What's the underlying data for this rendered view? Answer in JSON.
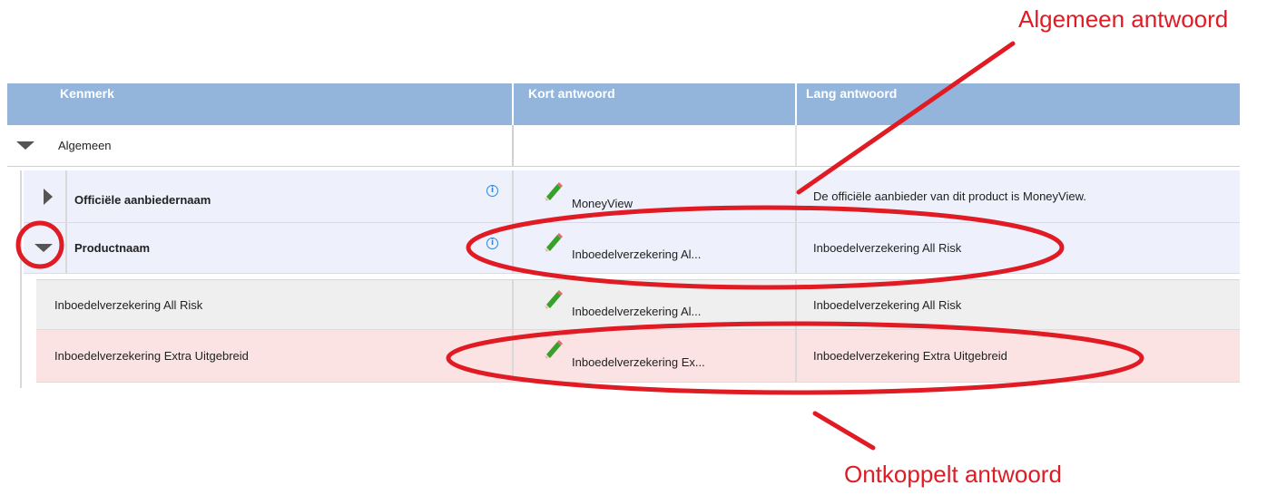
{
  "annotations": {
    "top_label": "Algemeen antwoord",
    "bottom_label": "Ontkoppelt antwoord",
    "color": "#e01b24"
  },
  "table": {
    "columns": [
      "Kenmerk",
      "Kort antwoord",
      "Lang antwoord"
    ],
    "group": {
      "label": "Algemeen",
      "expanded": true
    },
    "rows": [
      {
        "kenmerk": "Officiële aanbiedernaam",
        "kort": "MoneyView",
        "lang": "De officiële aanbieder van dit product is MoneyView.",
        "expander": "collapsed"
      },
      {
        "kenmerk": "Productnaam",
        "kort": "Inboedelverzekering Al...",
        "lang": "Inboedelverzekering All Risk",
        "expander": "expanded"
      }
    ],
    "subrows": [
      {
        "kenmerk": "Inboedelverzekering All Risk",
        "kort": "Inboedelverzekering Al...",
        "lang": "Inboedelverzekering All Risk"
      },
      {
        "kenmerk": "Inboedelverzekering Extra Uitgebreid",
        "kort": "Inboedelverzekering Ex...",
        "lang": "Inboedelverzekering Extra Uitgebreid"
      }
    ],
    "colors": {
      "header": "#93b5dc",
      "row_lavender": "#eef0fb",
      "row_grey": "#efefef",
      "row_highlight": "#fbe3e3"
    }
  }
}
